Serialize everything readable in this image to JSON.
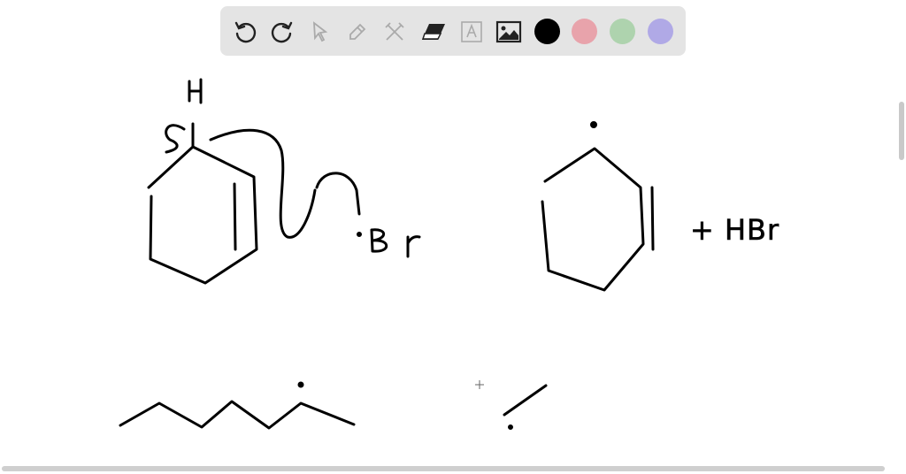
{
  "toolbar": {
    "tools": [
      "undo-icon",
      "redo-icon",
      "select-icon",
      "pen-icon",
      "tools-icon",
      "eraser-icon",
      "text-icon",
      "image-icon"
    ],
    "colors": {
      "black": "#000000",
      "pink": "#e8a3ab",
      "green": "#aed3ae",
      "purple": "#b0a9e6"
    },
    "background": "#e4e4e4"
  },
  "drawing": {
    "handwritten_labels": [
      "H",
      "Br",
      "+ HBr"
    ]
  }
}
